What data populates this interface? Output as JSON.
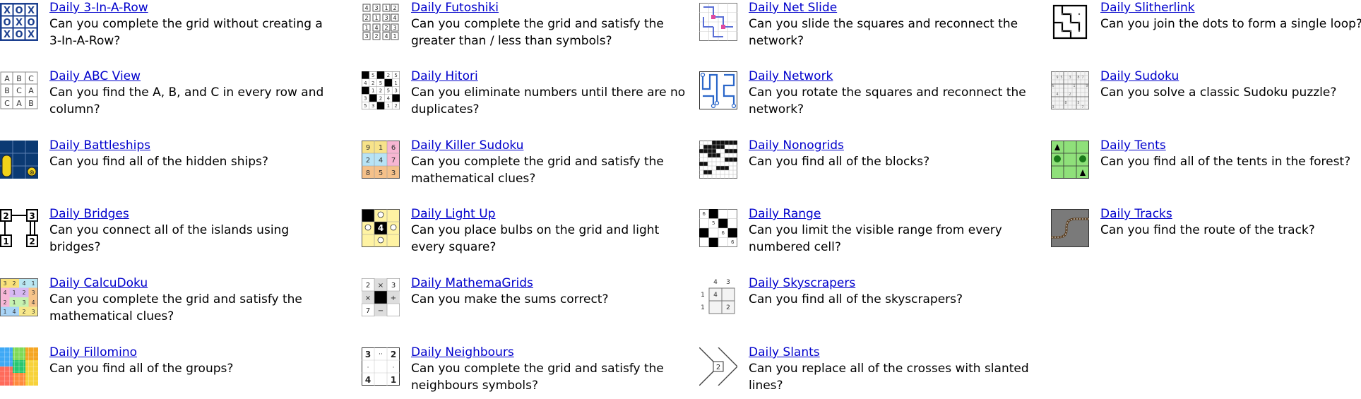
{
  "puzzles": [
    {
      "title": "Daily 3-In-A-Row",
      "desc": "Can you complete the grid without creating a 3-In-A-Row?",
      "icon": "three-in-a-row-icon"
    },
    {
      "title": "Daily ABC View",
      "desc": "Can you find the A, B, and C in every row and column?",
      "icon": "abc-view-icon"
    },
    {
      "title": "Daily Battleships",
      "desc": "Can you find all of the hidden ships?",
      "icon": "battleships-icon"
    },
    {
      "title": "Daily Bridges",
      "desc": "Can you connect all of the islands using bridges?",
      "icon": "bridges-icon"
    },
    {
      "title": "Daily CalcuDoku",
      "desc": "Can you complete the grid and satisfy the mathematical clues?",
      "icon": "calcudoku-icon"
    },
    {
      "title": "Daily Fillomino",
      "desc": "Can you find all of the groups?",
      "icon": "fillomino-icon"
    },
    {
      "title": "Daily Futoshiki",
      "desc": "Can you complete the grid and satisfy the greater than / less than symbols?",
      "icon": "futoshiki-icon"
    },
    {
      "title": "Daily Hitori",
      "desc": "Can you eliminate numbers until there are no duplicates?",
      "icon": "hitori-icon"
    },
    {
      "title": "Daily Killer Sudoku",
      "desc": "Can you complete the grid and satisfy the mathematical clues?",
      "icon": "killer-sudoku-icon"
    },
    {
      "title": "Daily Light Up",
      "desc": "Can you place bulbs on the grid and light every square?",
      "icon": "light-up-icon"
    },
    {
      "title": "Daily MathemaGrids",
      "desc": "Can you make the sums correct?",
      "icon": "mathemagrids-icon"
    },
    {
      "title": "Daily Neighbours",
      "desc": "Can you complete the grid and satisfy the neighbours symbols?",
      "icon": "neighbours-icon"
    },
    {
      "title": "Daily Net Slide",
      "desc": "Can you slide the squares and reconnect the network?",
      "icon": "net-slide-icon"
    },
    {
      "title": "Daily Network",
      "desc": "Can you rotate the squares and reconnect the network?",
      "icon": "network-icon"
    },
    {
      "title": "Daily Nonogrids",
      "desc": "Can you find all of the blocks?",
      "icon": "nonogrids-icon"
    },
    {
      "title": "Daily Range",
      "desc": "Can you limit the visible range from every numbered cell?",
      "icon": "range-icon"
    },
    {
      "title": "Daily Skyscrapers",
      "desc": "Can you find all of the skyscrapers?",
      "icon": "skyscrapers-icon"
    },
    {
      "title": "Daily Slants",
      "desc": "Can you replace all of the crosses with slanted lines?",
      "icon": "slants-icon"
    },
    {
      "title": "Daily Slitherlink",
      "desc": "Can you join the dots to form a single loop?",
      "icon": "slitherlink-icon"
    },
    {
      "title": "Daily Sudoku",
      "desc": "Can you solve a classic Sudoku puzzle?",
      "icon": "sudoku-icon"
    },
    {
      "title": "Daily Tents",
      "desc": "Can you find all of the tents in the forest?",
      "icon": "tents-icon"
    },
    {
      "title": "Daily Tracks",
      "desc": "Can you find the route of the track?",
      "icon": "tracks-icon"
    }
  ],
  "glyphs": {
    "three_in_a_row": [
      "X",
      "O",
      "X",
      "O",
      "X",
      "O",
      "X",
      "O",
      "X"
    ],
    "abc_view": [
      "A",
      "B",
      "C",
      "B",
      "C",
      "A",
      "C",
      "A",
      "B"
    ],
    "bridges": [
      "2",
      "3",
      "1",
      "2"
    ],
    "calcudoku": [
      "3",
      "2",
      "4",
      "1",
      "4",
      "1",
      "2",
      "3",
      "2",
      "1",
      "3",
      "4",
      "1",
      "4",
      "2",
      "3"
    ],
    "futoshiki": [
      "4",
      "3",
      "1",
      "2",
      "2",
      "1",
      "3",
      "4",
      "1",
      "4",
      "2",
      "3",
      "3",
      "2",
      "4",
      "1"
    ],
    "hitori": [
      "1",
      "5",
      "3",
      "2",
      "5",
      "4",
      "2",
      "5",
      "3",
      "1",
      "4",
      "1",
      "2",
      "5",
      "3",
      "3",
      "1",
      "2",
      "4",
      "5",
      "5",
      "3",
      "4",
      "1",
      "2"
    ],
    "killer_sudoku": [
      "9",
      "1",
      "6",
      "2",
      "4",
      "7",
      "8",
      "5",
      "3"
    ],
    "light_up": [
      "4"
    ],
    "mathemagrids": [
      "2",
      "×",
      "3",
      "×",
      "+",
      "7",
      "−"
    ],
    "neighbours": [
      "3",
      "··",
      "2",
      "·",
      "·",
      "4",
      "1"
    ],
    "range": [
      "6",
      "5",
      "6",
      "6"
    ],
    "skyscrapers": [
      "4",
      "3",
      "1",
      "4",
      "1",
      "2"
    ],
    "slants": [
      "2"
    ],
    "sudoku": [
      "9",
      "5",
      "3",
      "8",
      "7",
      "6",
      "1",
      "9",
      "4",
      "2",
      "8",
      "5",
      "3",
      "7"
    ]
  },
  "colors": {
    "link": "#0000cc",
    "battleship_bg": "#0b3a73",
    "light_up_bg": "#fff3a3",
    "tents_bg": "#8fe07a"
  }
}
